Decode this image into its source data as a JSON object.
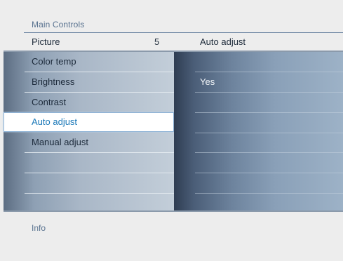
{
  "header": {
    "title": "Main Controls",
    "left_label": "Picture",
    "left_value": "5",
    "right_label": "Auto adjust"
  },
  "menu": {
    "items": [
      {
        "label": "Color temp",
        "selected": false
      },
      {
        "label": "Brightness",
        "selected": false
      },
      {
        "label": "Contrast",
        "selected": false
      },
      {
        "label": "Auto adjust",
        "selected": true
      },
      {
        "label": "Manual adjust",
        "selected": false
      },
      {
        "label": "",
        "selected": false
      },
      {
        "label": "",
        "selected": false
      },
      {
        "label": "",
        "selected": false
      }
    ]
  },
  "submenu": {
    "options": [
      "Yes"
    ]
  },
  "footer": {
    "info_label": "Info"
  },
  "colors": {
    "accent": "#1a78b8",
    "background": "#ededed",
    "header_text": "#5a7390"
  }
}
